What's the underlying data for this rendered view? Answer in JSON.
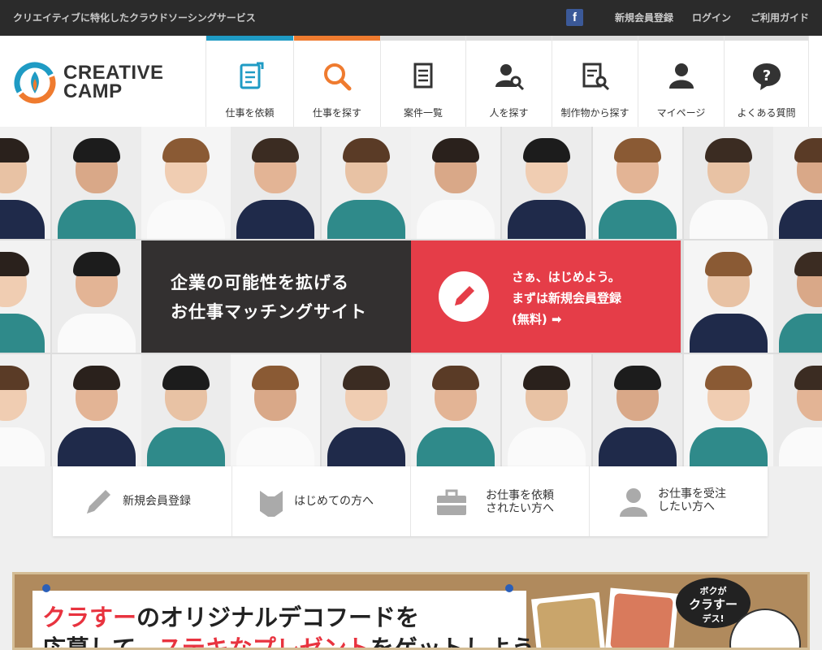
{
  "topbar": {
    "tagline": "クリエイティブに特化したクラウドソーシングサービス",
    "links": {
      "register": "新規会員登録",
      "login": "ログイン",
      "guide": "ご利用ガイド"
    },
    "facebook_icon": "facebook-icon"
  },
  "logo": {
    "line1": "CREATIVE",
    "line2": "CAMP",
    "colors": {
      "blue": "#1f9bc4",
      "orange": "#ef7b2f"
    }
  },
  "nav": [
    {
      "label": "仕事を依頼",
      "icon": "document-pen-icon",
      "accent": "#1f9bc4"
    },
    {
      "label": "仕事を探す",
      "icon": "magnifier-icon",
      "accent": "#ef7b2f"
    },
    {
      "label": "案件一覧",
      "icon": "document-list-icon",
      "accent": "#dedede"
    },
    {
      "label": "人を探す",
      "icon": "person-search-icon",
      "accent": "#dedede"
    },
    {
      "label": "制作物から探す",
      "icon": "document-search-icon",
      "accent": "#dedede"
    },
    {
      "label": "マイページ",
      "icon": "person-icon",
      "accent": "#dedede"
    },
    {
      "label": "よくある質問",
      "icon": "question-icon",
      "accent": "#dedede"
    }
  ],
  "hero": {
    "tagline_line1": "企業の可能性を拡げる",
    "tagline_line2": "お仕事マッチングサイト",
    "cta_line1": "さぁ、はじめよう。",
    "cta_line2": "まずは新規会員登録",
    "cta_line3": "(無料)",
    "cta_arrow": "➡",
    "cta_color": "#e53d48"
  },
  "subnav": [
    {
      "line1": "新規会員登録",
      "line2": "",
      "icon": "pencil-icon"
    },
    {
      "line1": "はじめての方へ",
      "line2": "",
      "icon": "bookmark-icon"
    },
    {
      "line1": "お仕事を依頼",
      "line2": "されたい方へ",
      "icon": "briefcase-icon"
    },
    {
      "line1": "お仕事を受注",
      "line2": "したい方へ",
      "icon": "user-icon"
    }
  ],
  "banner": {
    "line1_red": "クラすー",
    "line1_rest": "のオリジナルデコフードを",
    "line2_a": "応募して、",
    "line2_red": "ステキなプレゼント",
    "line2_b": "をゲットしよう!",
    "bubble_1": "ボクが",
    "bubble_2": "クラすー",
    "bubble_3": "デス!"
  }
}
